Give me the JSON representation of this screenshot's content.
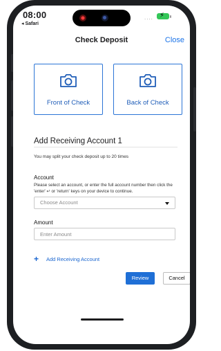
{
  "status_bar": {
    "time": "08:00",
    "back_app": "◂ Safari",
    "signal": "....",
    "battery_color": "#34c759"
  },
  "nav": {
    "title": "Check Deposit",
    "close_label": "Close"
  },
  "photos": {
    "front_label": "Front of Check",
    "back_label": "Back of Check",
    "icon": "camera-icon"
  },
  "form": {
    "section_title": "Add Receiving Account 1",
    "split_hint": "You may split your check deposit up to 20 times",
    "account_label": "Account",
    "account_help": "Please select an account, or enter the full account number then click the 'enter' ↵ or 'return' keys on your device to continue.",
    "account_placeholder": "Choose Account",
    "amount_label": "Amount",
    "amount_placeholder": "Enter Amount",
    "add_account_label": "Add Receiving Account",
    "review_label": "Review",
    "cancel_label": "Cancel"
  },
  "colors": {
    "accent": "#1f6fd6",
    "link": "#1a66d0",
    "frame": "#1d1f22"
  }
}
